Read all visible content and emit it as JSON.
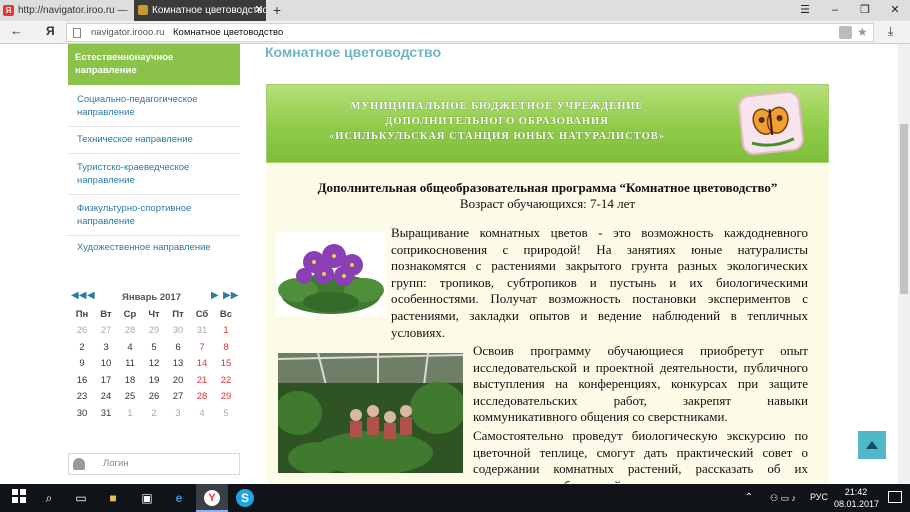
{
  "browser": {
    "tab1_title": "http://navigator.iroo.ru —",
    "tab2_title": "Комнатное цветоводство",
    "address_domain": "navigator.irooo.ru",
    "address_title": "Комнатное цветоводство",
    "back_glyph": "←",
    "yandex_glyph": "Я"
  },
  "sidebar": {
    "items": [
      {
        "label": "Естественнонаучное направление",
        "active": true
      },
      {
        "label": "Социально-педагогическое направление"
      },
      {
        "label": "Техническое направление"
      },
      {
        "label": "Туристско-краеведческое направление"
      },
      {
        "label": "Физкультурно-спортивное направление"
      },
      {
        "label": "Художественное направление"
      }
    ],
    "calendar": {
      "month": "Январь 2017",
      "weekdays": [
        "Пн",
        "Вт",
        "Ср",
        "Чт",
        "Пт",
        "Сб",
        "Вс"
      ],
      "rows": [
        [
          "26",
          "27",
          "28",
          "29",
          "30",
          "31",
          "1"
        ],
        [
          "2",
          "3",
          "4",
          "5",
          "6",
          "7",
          "8"
        ],
        [
          "9",
          "10",
          "11",
          "12",
          "13",
          "14",
          "15"
        ],
        [
          "16",
          "17",
          "18",
          "19",
          "20",
          "21",
          "22"
        ],
        [
          "23",
          "24",
          "25",
          "26",
          "27",
          "28",
          "29"
        ],
        [
          "30",
          "31",
          "1",
          "2",
          "3",
          "4",
          "5"
        ]
      ]
    },
    "login_placeholder": "Логин"
  },
  "content": {
    "page_title": "Комнатное цветоводство",
    "banner": {
      "line1": "МУНИЦИПАЛЬНОЕ БЮДЖЕТНОЕ УЧРЕЖДЕНИЕ",
      "line2": "ДОПОЛНИТЕЛЬНОГО ОБРАЗОВАНИЯ",
      "line3": "«ИСИЛЬКУЛЬСКАЯ СТАНЦИЯ ЮНЫХ НАТУРАЛИСТОВ»"
    },
    "program_title": "Дополнительная общеобразовательная программа “Комнатное цветоводство”",
    "age": "Возраст обучающихся: 7-14 лет",
    "para1": "Выращивание комнатных цветов - это возможность каждодневного соприкосновения с природой! На занятиях юные натуралисты познакомятся с растениями закрытого грунта разных экологических групп: тропиков, субтропиков и пустынь и их биологическими особенностями. Получат возможность постановки экспериментов с растениями, закладки опытов и ведение наблюдений в тепличных условиях.",
    "para2": "Освоив программу обучающиеся приобретут опыт исследовательской и проектной деятельности, публичного выступления на конференциях, конкурсах при защите исследовательских работ, закрепят навыки коммуникативного общения со сверстниками.",
    "para3": "Самостоятельно проведут биологическую экскурсию по цветочной теплице, смогут дать практический совет о содержании комнатных растений, рассказать об их полезных и лечебных свойствах."
  },
  "taskbar": {
    "lang": "РУС",
    "time": "21:42",
    "date": "08.01.2017"
  }
}
